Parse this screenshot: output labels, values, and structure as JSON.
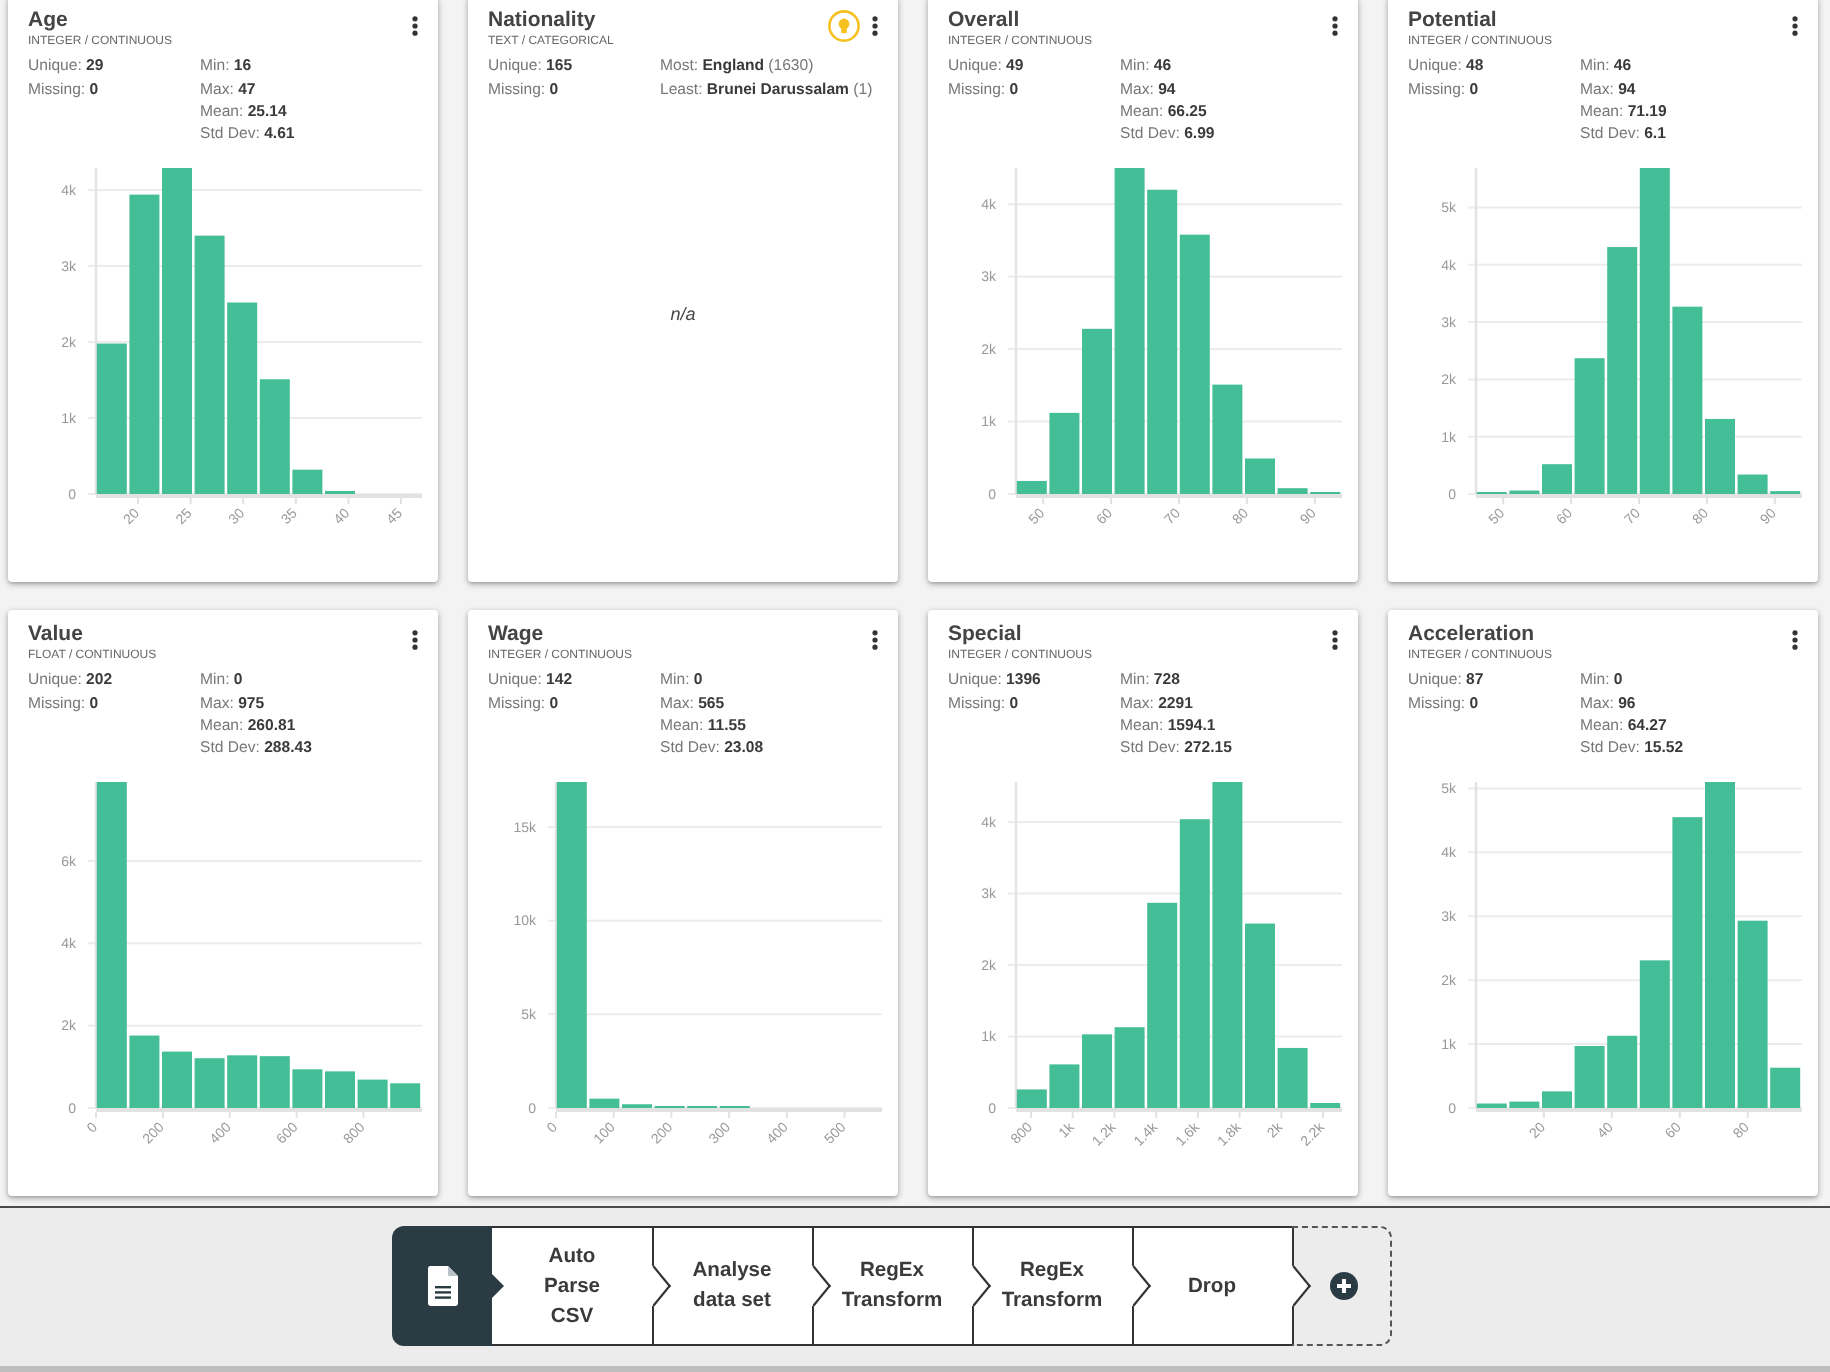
{
  "cards": [
    {
      "title": "Age",
      "type": "INTEGER / CONTINUOUS",
      "hint_icon": false,
      "stats_left": [
        "Unique: **29**",
        "Missing: **0**"
      ],
      "stats_right": [
        "Min: **16**",
        "Max: **47**",
        "Mean: **25.14**",
        "Std Dev: **4.61**"
      ],
      "chart_data": {
        "type": "bar",
        "x": [
          17.55,
          20.65,
          23.75,
          26.85,
          29.95,
          33.05,
          36.15,
          39.25,
          42.35,
          45.45
        ],
        "values": [
          1980,
          3940,
          4290,
          3400,
          2520,
          1510,
          320,
          40,
          0,
          0
        ],
        "xlim": [
          16,
          47
        ],
        "ylim": [
          0,
          4290
        ],
        "xticks": [
          20,
          25,
          30,
          35,
          40,
          45
        ],
        "yticks": [
          {
            "value": 0,
            "label": "0"
          },
          {
            "value": 1000,
            "label": "1k"
          },
          {
            "value": 2000,
            "label": "2k"
          },
          {
            "value": 3000,
            "label": "3k"
          },
          {
            "value": 4000,
            "label": "4k"
          }
        ],
        "grid": true
      }
    },
    {
      "title": "Nationality",
      "type": "TEXT / CATEGORICAL",
      "hint_icon": true,
      "stats_left": [
        "Unique: **165**",
        "Missing: **0**"
      ],
      "stats_right": [
        "Most: **England** (1630)",
        "Least: **Brunei Darussalam** (1)"
      ],
      "no_chart_text": "n/a"
    },
    {
      "title": "Overall",
      "type": "INTEGER / CONTINUOUS",
      "hint_icon": false,
      "stats_left": [
        "Unique: **49**",
        "Missing: **0**"
      ],
      "stats_right": [
        "Min: **46**",
        "Max: **94**",
        "Mean: **66.25**",
        "Std Dev: **6.99**"
      ],
      "chart_data": {
        "type": "bar",
        "x": [
          48.4,
          53.2,
          58,
          62.8,
          67.6,
          72.4,
          77.2,
          82,
          86.8,
          91.6
        ],
        "values": [
          180,
          1120,
          2280,
          4500,
          4200,
          3580,
          1510,
          490,
          80,
          20
        ],
        "xlim": [
          46,
          94
        ],
        "ylim": [
          0,
          4500
        ],
        "xticks": [
          50,
          60,
          70,
          80,
          90
        ],
        "yticks": [
          {
            "value": 0,
            "label": "0"
          },
          {
            "value": 1000,
            "label": "1k"
          },
          {
            "value": 2000,
            "label": "2k"
          },
          {
            "value": 3000,
            "label": "3k"
          },
          {
            "value": 4000,
            "label": "4k"
          }
        ],
        "grid": true
      }
    },
    {
      "title": "Potential",
      "type": "INTEGER / CONTINUOUS",
      "hint_icon": false,
      "stats_left": [
        "Unique: **48**",
        "Missing: **0**"
      ],
      "stats_right": [
        "Min: **46**",
        "Max: **94**",
        "Mean: **71.19**",
        "Std Dev: **6.1**"
      ],
      "chart_data": {
        "type": "bar",
        "x": [
          48.4,
          53.2,
          58,
          62.8,
          67.6,
          72.4,
          77.2,
          82,
          86.8,
          91.6
        ],
        "values": [
          20,
          60,
          520,
          2370,
          4310,
          5690,
          3270,
          1310,
          340,
          50
        ],
        "xlim": [
          46,
          94
        ],
        "ylim": [
          0,
          5690
        ],
        "xticks": [
          50,
          60,
          70,
          80,
          90
        ],
        "yticks": [
          {
            "value": 0,
            "label": "0"
          },
          {
            "value": 1000,
            "label": "1k"
          },
          {
            "value": 2000,
            "label": "2k"
          },
          {
            "value": 3000,
            "label": "3k"
          },
          {
            "value": 4000,
            "label": "4k"
          },
          {
            "value": 5000,
            "label": "5k"
          }
        ],
        "grid": true
      }
    },
    {
      "title": "Value",
      "type": "FLOAT / CONTINUOUS",
      "hint_icon": false,
      "stats_left": [
        "Unique: **202**",
        "Missing: **0**"
      ],
      "stats_right": [
        "Min: **0**",
        "Max: **975**",
        "Mean: **260.81**",
        "Std Dev: **288.43**"
      ],
      "chart_data": {
        "type": "bar",
        "x": [
          48.75,
          146.25,
          243.75,
          341.25,
          438.75,
          536.25,
          633.75,
          731.25,
          828.75,
          926.25
        ],
        "values": [
          7920,
          1760,
          1370,
          1210,
          1280,
          1260,
          940,
          890,
          690,
          600
        ],
        "xlim": [
          0,
          975
        ],
        "ylim": [
          0,
          7920
        ],
        "xticks": [
          0,
          200,
          400,
          600,
          800
        ],
        "yticks": [
          {
            "value": 0,
            "label": "0"
          },
          {
            "value": 2000,
            "label": "2k"
          },
          {
            "value": 4000,
            "label": "4k"
          },
          {
            "value": 6000,
            "label": "6k"
          }
        ],
        "grid": true
      }
    },
    {
      "title": "Wage",
      "type": "INTEGER / CONTINUOUS",
      "hint_icon": false,
      "stats_left": [
        "Unique: **142**",
        "Missing: **0**"
      ],
      "stats_right": [
        "Min: **0**",
        "Max: **565**",
        "Mean: **11.55**",
        "Std Dev: **23.08**"
      ],
      "chart_data": {
        "type": "bar",
        "x": [
          28.25,
          84.75,
          141.25,
          197.75,
          254.25,
          310.75,
          367.25,
          423.75,
          480.25,
          536.75
        ],
        "values": [
          17400,
          500,
          200,
          100,
          50,
          50,
          0,
          0,
          0,
          0
        ],
        "xlim": [
          0,
          565
        ],
        "ylim": [
          0,
          17400
        ],
        "xticks": [
          0,
          100,
          200,
          300,
          400,
          500
        ],
        "yticks": [
          {
            "value": 0,
            "label": "0"
          },
          {
            "value": 5000,
            "label": "5k"
          },
          {
            "value": 10000,
            "label": "10k"
          },
          {
            "value": 15000,
            "label": "15k"
          }
        ],
        "grid": true
      }
    },
    {
      "title": "Special",
      "type": "INTEGER / CONTINUOUS",
      "hint_icon": false,
      "stats_left": [
        "Unique: **1396**",
        "Missing: **0**"
      ],
      "stats_right": [
        "Min: **728**",
        "Max: **2291**",
        "Mean: **1594.1**",
        "Std Dev: **272.15**"
      ],
      "chart_data": {
        "type": "bar",
        "x": [
          806.15,
          962.45,
          1118.75,
          1275.05,
          1431.35,
          1587.65,
          1743.95,
          1900.25,
          2056.55,
          2212.85
        ],
        "values": [
          260,
          610,
          1030,
          1130,
          2870,
          4040,
          4560,
          2580,
          840,
          70
        ],
        "xlim": [
          728,
          2291
        ],
        "ylim": [
          0,
          4560
        ],
        "xticks": [
          800,
          {
            "value": 1000,
            "label": "1k"
          },
          {
            "value": 1200,
            "label": "1.2k"
          },
          {
            "value": 1400,
            "label": "1.4k"
          },
          {
            "value": 1600,
            "label": "1.6k"
          },
          {
            "value": 1800,
            "label": "1.8k"
          },
          {
            "value": 2000,
            "label": "2k"
          },
          {
            "value": 2200,
            "label": "2.2k"
          }
        ],
        "yticks": [
          {
            "value": 0,
            "label": "0"
          },
          {
            "value": 1000,
            "label": "1k"
          },
          {
            "value": 2000,
            "label": "2k"
          },
          {
            "value": 3000,
            "label": "3k"
          },
          {
            "value": 4000,
            "label": "4k"
          }
        ],
        "grid": true
      }
    },
    {
      "title": "Acceleration",
      "type": "INTEGER / CONTINUOUS",
      "hint_icon": false,
      "stats_left": [
        "Unique: **87**",
        "Missing: **0**"
      ],
      "stats_right": [
        "Min: **0**",
        "Max: **96**",
        "Mean: **64.27**",
        "Std Dev: **15.52**"
      ],
      "chart_data": {
        "type": "bar",
        "x": [
          4.8,
          14.4,
          24,
          33.6,
          43.2,
          52.8,
          62.4,
          72,
          81.6,
          91.2
        ],
        "values": [
          70,
          100,
          260,
          970,
          1130,
          2310,
          4550,
          5100,
          2930,
          630
        ],
        "xlim": [
          0,
          96
        ],
        "ylim": [
          0,
          5100
        ],
        "xticks": [
          20,
          40,
          60,
          80
        ],
        "yticks": [
          {
            "value": 0,
            "label": "0"
          },
          {
            "value": 1000,
            "label": "1k"
          },
          {
            "value": 2000,
            "label": "2k"
          },
          {
            "value": 3000,
            "label": "3k"
          },
          {
            "value": 4000,
            "label": "4k"
          },
          {
            "value": 5000,
            "label": "5k"
          }
        ],
        "grid": true
      }
    }
  ],
  "pipeline": {
    "steps": [
      {
        "kind": "source"
      },
      {
        "kind": "step",
        "label": "Auto\nParse\nCSV"
      },
      {
        "kind": "step",
        "label": "Analyse\ndata set"
      },
      {
        "kind": "step",
        "label": "RegEx\nTransform"
      },
      {
        "kind": "step",
        "label": "RegEx\nTransform"
      },
      {
        "kind": "step",
        "label": "Drop"
      },
      {
        "kind": "add"
      }
    ]
  }
}
